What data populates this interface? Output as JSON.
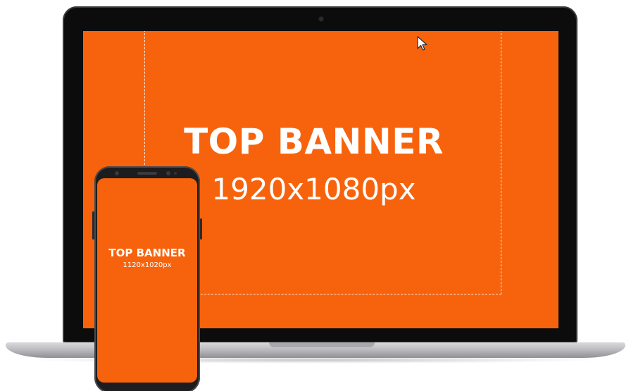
{
  "laptop": {
    "screen": {
      "title": "TOP BANNER",
      "size": "1920x1080px",
      "background_color": "#f7630c",
      "cursor_icon": "arrow-cursor-icon"
    }
  },
  "phone": {
    "screen": {
      "title": "TOP BANNER",
      "size": "1120x1020px",
      "background_color": "#f7630c"
    }
  },
  "colors": {
    "accent": "#f7630c",
    "device_frame": "#0c0c0c",
    "text": "#ffffff"
  }
}
